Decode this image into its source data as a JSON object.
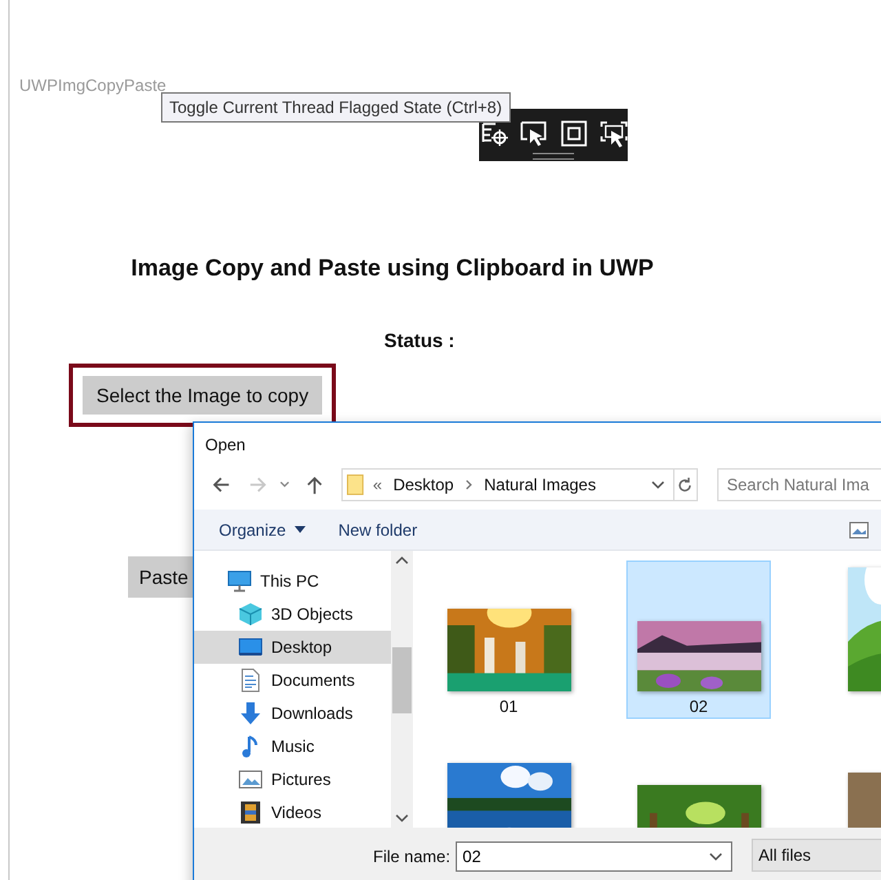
{
  "app": {
    "title": "UWPImgCopyPaste",
    "heading": "Image Copy and Paste using Clipboard in UWP",
    "status_label": "Status :",
    "select_button": "Select the Image to copy",
    "paste_button": "Paste"
  },
  "tooltip": "Toggle Current Thread Flagged State (Ctrl+8)",
  "dialog": {
    "title": "Open",
    "nav": {
      "back_disabled": false,
      "forward_disabled": true
    },
    "address": {
      "overflow": "«",
      "breadcrumb": [
        "Desktop",
        "Natural Images"
      ]
    },
    "search": {
      "placeholder": "Search Natural Ima"
    },
    "toolbar": {
      "organize": "Organize",
      "new_folder": "New folder"
    },
    "sidebar": [
      {
        "label": "This PC",
        "kind": "pc",
        "selected": false,
        "children": [
          {
            "label": "3D Objects",
            "kind": "cube",
            "selected": false
          },
          {
            "label": "Desktop",
            "kind": "desktop",
            "selected": true
          },
          {
            "label": "Documents",
            "kind": "document",
            "selected": false
          },
          {
            "label": "Downloads",
            "kind": "download",
            "selected": false
          },
          {
            "label": "Music",
            "kind": "music",
            "selected": false
          },
          {
            "label": "Pictures",
            "kind": "pictures",
            "selected": false
          },
          {
            "label": "Videos",
            "kind": "video",
            "selected": false
          }
        ]
      }
    ],
    "files": [
      {
        "name": "01",
        "kind": "picture",
        "selected": false
      },
      {
        "name": "02",
        "kind": "picture",
        "selected": true
      },
      {
        "kind": "picture",
        "selected": false
      },
      {
        "kind": "picture",
        "selected": false
      },
      {
        "kind": "picture",
        "selected": false
      },
      {
        "kind": "picture",
        "selected": false
      }
    ],
    "file_name": {
      "label": "File name:",
      "value": "02"
    },
    "filter": "All files"
  }
}
